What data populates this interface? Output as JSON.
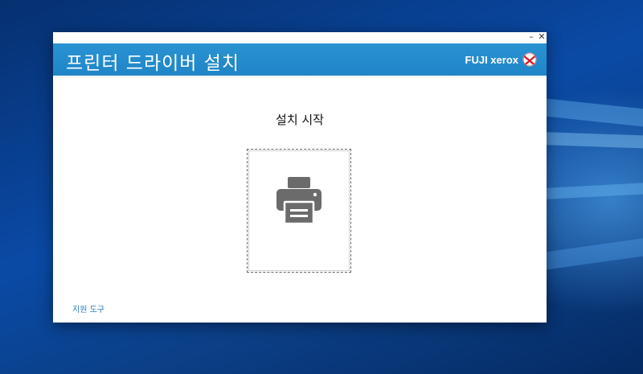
{
  "window": {
    "title": "프린터 드라이버 설치",
    "brand": "FUJI xerox",
    "minimize_glyph": "–",
    "close_glyph": "✕"
  },
  "main": {
    "heading": "설치 시작",
    "tile_icon": "printer-icon"
  },
  "footer": {
    "support_link": "지원 도구"
  },
  "colors": {
    "banner": "#1f85c8",
    "link": "#2a7fc0",
    "icon": "#6b6b6b",
    "brand_red": "#d51f2a"
  }
}
